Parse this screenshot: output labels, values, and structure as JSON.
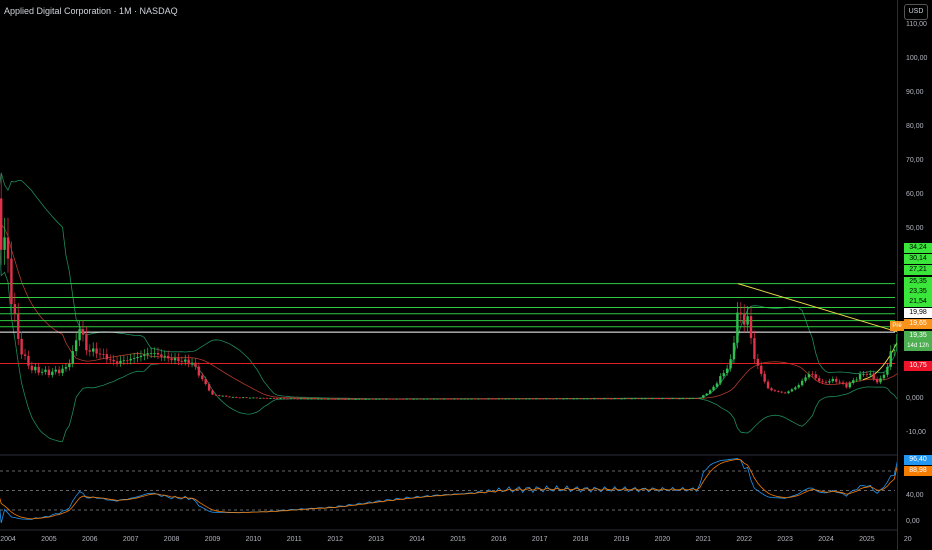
{
  "title": "Applied Digital Corporation · 1M · NASDAQ",
  "currency_button": "USD",
  "price_axis": [
    "110,00",
    "100,00",
    "90,00",
    "80,00",
    "70,00",
    "60,00",
    "50,00",
    "0,000",
    "-10,00"
  ],
  "price_axis_values": [
    110,
    100,
    90,
    80,
    70,
    60,
    50,
    0,
    -10
  ],
  "levels": [
    {
      "label": "34,24",
      "value": 34.24,
      "color": "#2ecc40",
      "box": "#39e639"
    },
    {
      "label": "30,14",
      "value": 30.14,
      "color": "#2ecc40",
      "box": "#39e639"
    },
    {
      "label": "27,21",
      "value": 27.21,
      "color": "#2ecc40",
      "box": "#39e639"
    },
    {
      "label": "25,35",
      "value": 25.35,
      "color": "#2ecc40",
      "box": "#39e639"
    },
    {
      "label": "23,35",
      "value": 23.35,
      "color": "#2ecc40",
      "box": "#39e639"
    },
    {
      "label": "21,54",
      "value": 21.54,
      "color": "#2ecc40",
      "box": "#39e639"
    },
    {
      "label": "19,98",
      "value": 19.98,
      "color": "#ffffff",
      "box": "#ffffff"
    },
    {
      "label": "10,75",
      "value": 10.75,
      "color": "#e02020",
      "box": "#f0142a"
    }
  ],
  "premarket": {
    "tag": "Pré",
    "price": "19,65"
  },
  "last": {
    "price": "19,35",
    "countdown": "14d 12h"
  },
  "rsi": {
    "value1": "96,40",
    "value2": "88,98",
    "axis": [
      "40,00",
      "0,00"
    ],
    "color1": "#2196f3",
    "color2": "#f57c00"
  },
  "years": [
    "2004",
    "2005",
    "2006",
    "2007",
    "2008",
    "2009",
    "2010",
    "2011",
    "2012",
    "2013",
    "2014",
    "2015",
    "2016",
    "2017",
    "2018",
    "2019",
    "2020",
    "2021",
    "2022",
    "2023",
    "2024",
    "2025",
    "20"
  ],
  "chart_data": {
    "type": "candlestick",
    "interval": "1M",
    "close_keypoints": [
      [
        2003.75,
        55
      ],
      [
        2004.0,
        40
      ],
      [
        2004.2,
        20
      ],
      [
        2004.4,
        12
      ],
      [
        2004.6,
        9
      ],
      [
        2005.0,
        8
      ],
      [
        2005.4,
        9
      ],
      [
        2005.6,
        14
      ],
      [
        2005.75,
        22
      ],
      [
        2005.9,
        15
      ],
      [
        2006.2,
        14
      ],
      [
        2006.6,
        11
      ],
      [
        2007.0,
        12
      ],
      [
        2007.5,
        14
      ],
      [
        2008.0,
        12
      ],
      [
        2008.5,
        11
      ],
      [
        2008.75,
        6
      ],
      [
        2009.0,
        1.5
      ],
      [
        2009.5,
        0.8
      ],
      [
        2010.5,
        0.5
      ],
      [
        2012,
        0.3
      ],
      [
        2020.9,
        0.5
      ],
      [
        2021.2,
        3
      ],
      [
        2021.5,
        8
      ],
      [
        2021.7,
        12
      ],
      [
        2021.85,
        28
      ],
      [
        2021.95,
        22
      ],
      [
        2022.1,
        25
      ],
      [
        2022.2,
        14
      ],
      [
        2022.4,
        8
      ],
      [
        2022.6,
        3
      ],
      [
        2023.0,
        2
      ],
      [
        2023.3,
        4
      ],
      [
        2023.6,
        8
      ],
      [
        2023.9,
        5
      ],
      [
        2024.2,
        6
      ],
      [
        2024.5,
        4
      ],
      [
        2024.8,
        7
      ],
      [
        2025.0,
        8
      ],
      [
        2025.3,
        5
      ],
      [
        2025.5,
        10
      ],
      [
        2025.75,
        19.35
      ]
    ],
    "ylim": [
      -10,
      110
    ],
    "trendline": [
      [
        2021.85,
        34.24
      ],
      [
        2025.85,
        19.65
      ]
    ]
  }
}
